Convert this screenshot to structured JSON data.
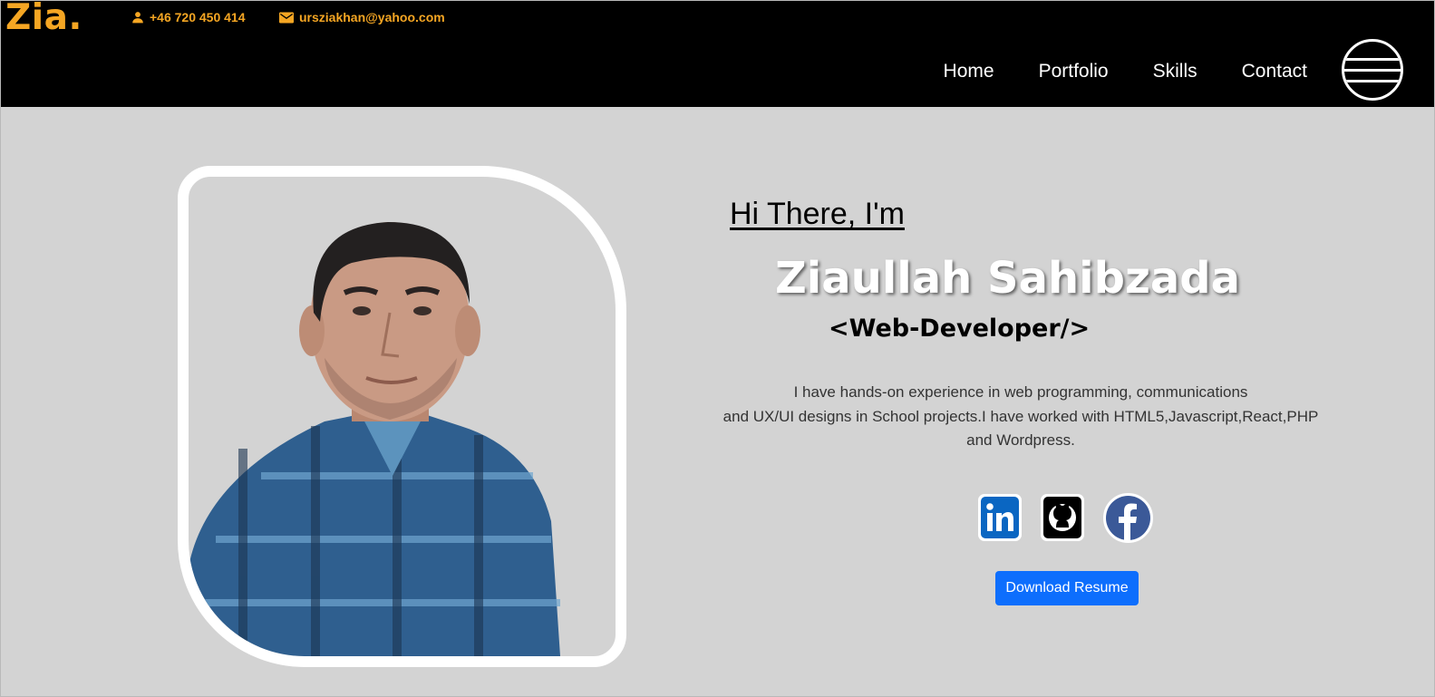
{
  "header": {
    "logo": "Zia.",
    "phone": "+46 720 450 414",
    "email": "ursziakhan@yahoo.com",
    "nav": [
      {
        "label": "Home"
      },
      {
        "label": "Portfolio"
      },
      {
        "label": "Skills"
      },
      {
        "label": "Contact"
      }
    ],
    "menu_icon": "striped-circle-menu-icon"
  },
  "hero": {
    "greeting": "Hi There, I'm",
    "name": "Ziaullah Sahibzada",
    "role": "<Web-Developer/>",
    "bio_lines": [
      "I have hands-on experience in web programming, communications",
      "and UX/UI designs in School projects.I have worked with HTML5,Javascript,React,PHP",
      "and Wordpress."
    ],
    "socials": [
      {
        "name": "linkedin",
        "icon": "linkedin-icon",
        "color": "#0a66c2"
      },
      {
        "name": "github",
        "icon": "github-icon",
        "color": "#000000"
      },
      {
        "name": "facebook",
        "icon": "facebook-icon",
        "color": "#3b5998"
      }
    ],
    "download_label": "Download Resume"
  },
  "colors": {
    "accent": "#f5a623",
    "header_bg": "#000000",
    "page_bg": "#d3d3d3",
    "button": "#0d6efd"
  }
}
